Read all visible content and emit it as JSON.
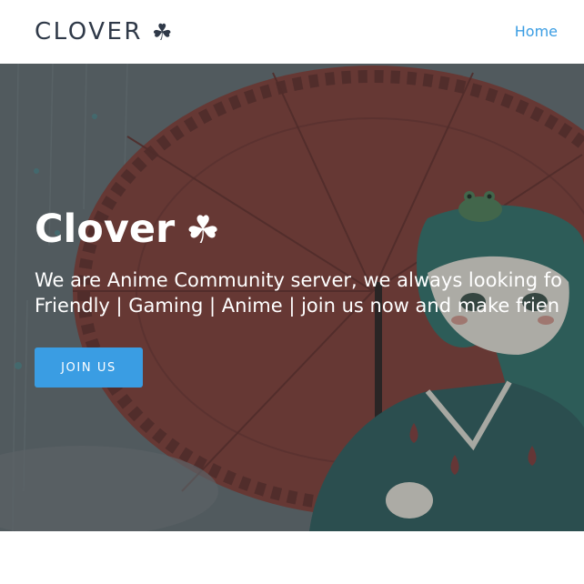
{
  "navbar": {
    "brand_text": "CLOVER",
    "brand_icon": "clover-icon",
    "brand_glyph": "☘",
    "links": [
      {
        "label": "Home"
      }
    ],
    "link_color": "#3a9de3"
  },
  "hero": {
    "title": "Clover",
    "title_glyph": "☘",
    "subtitle_line1": "We are Anime Community server, we always looking fo",
    "subtitle_line2": "Friendly | Gaming | Anime | join us now and make frien",
    "button_label": "JOIN US",
    "button_color": "#3a9de3"
  }
}
